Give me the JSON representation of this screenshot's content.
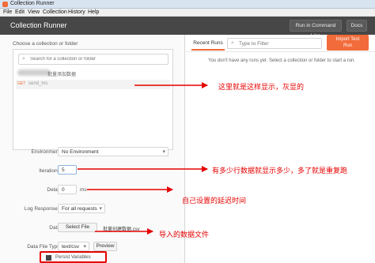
{
  "window": {
    "title": "Collection Runner"
  },
  "menu": [
    "File",
    "Edit",
    "View",
    "Collection",
    "History",
    "Help"
  ],
  "header": {
    "title": "Collection Runner",
    "run_cmd_label": "Run in Command Line",
    "docs_label": "Docs"
  },
  "left": {
    "section_label": "Choose a collection or folder",
    "search_placeholder": "Search for a collection or folder",
    "collections": [
      {
        "label": "批量添加数据"
      },
      {
        "label": "send_ms"
      }
    ],
    "environment": {
      "label": "Environment",
      "value": "No Environment"
    },
    "iterations": {
      "label": "Iterations",
      "value": "5"
    },
    "delay": {
      "label": "Delay",
      "value": "0",
      "unit": "ms"
    },
    "log_responses": {
      "label": "Log Responses",
      "value": "For all requests"
    },
    "data": {
      "label": "Data",
      "button": "Select File",
      "file_name": "批量创建数据.csv"
    },
    "data_file_type": {
      "label": "Data File Type",
      "value": "text/csv",
      "preview": "Preview"
    },
    "persist": {
      "label": "Persist Variables"
    }
  },
  "right": {
    "tab_recent": "Recent Runs",
    "filter_placeholder": "Type to Filter",
    "import_button_line1": "Import Test",
    "import_button_line2": "Run",
    "empty_message": "You don't have any runs yet. Select a collection or folder to start a run."
  },
  "annotations": {
    "a1": "这里就是这样显示，灰显的",
    "a2": "有多少行数据就显示多少，多了就是重复跑",
    "a3": "自己设置的延迟时间",
    "a4": "导入的数据文件"
  },
  "colors": {
    "accent": "#f26b3a",
    "header": "#474747",
    "annotation": "#e60000"
  }
}
